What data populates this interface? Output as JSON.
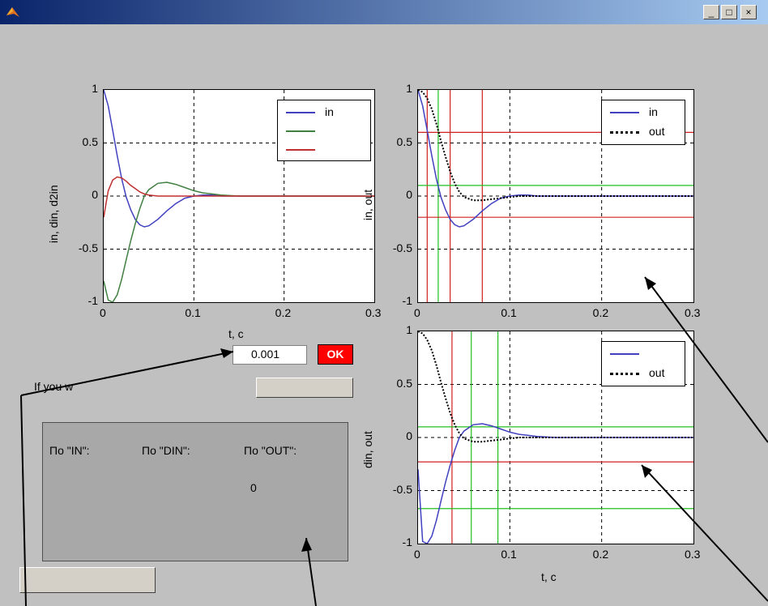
{
  "window": {
    "title": "",
    "minimize_label": "_",
    "maximize_label": "□",
    "close_label": "×"
  },
  "menu": {
    "items": [
      "",
      "",
      "",
      "",
      "",
      ""
    ]
  },
  "figure_title": "",
  "ticks": {
    "y": [
      "1",
      "0.5",
      "0",
      "-0.5",
      "-1"
    ],
    "x": [
      "0",
      "0.1",
      "0.2",
      "0.3"
    ]
  },
  "plots": [
    {
      "id": "plot-in-din-d2in",
      "ylabel": "in, din, d2in",
      "xlabel": "t, c",
      "legend": [
        "in",
        "",
        ""
      ],
      "colors": [
        "#4040c0",
        "#408040",
        "#c03030"
      ],
      "hidden_y_labels": [
        "",
        ""
      ]
    },
    {
      "id": "plot-in-out",
      "ylabel": "in, out",
      "xlabel": "",
      "legend": [
        "in",
        "out"
      ],
      "colors": [
        "#4040c0",
        "#000000"
      ],
      "vlines_red": [
        0.01,
        0.035,
        0.07
      ],
      "vlines_green": [
        0.022
      ],
      "hlines_red": [
        0.6,
        -0.2
      ],
      "hlines_green": [
        0.1
      ]
    },
    {
      "id": "plot-din-out",
      "ylabel": "din, out",
      "xlabel": "t, c",
      "legend": [
        "",
        "out"
      ],
      "colors": [
        "#4040c0",
        "#000000"
      ],
      "vlines_red": [
        0.037
      ],
      "vlines_green": [
        0.058,
        0.087
      ],
      "hlines_red": [
        -0.23
      ],
      "hlines_green": [
        0.1,
        -0.67
      ]
    }
  ],
  "chart_data": [
    {
      "type": "line",
      "x": [
        0,
        0.005,
        0.01,
        0.015,
        0.02,
        0.025,
        0.03,
        0.035,
        0.04,
        0.045,
        0.05,
        0.06,
        0.07,
        0.08,
        0.09,
        0.1,
        0.11,
        0.12,
        0.13,
        0.15,
        0.2,
        0.25,
        0.3
      ],
      "series": [
        {
          "name": "in",
          "values": [
            1,
            0.85,
            0.62,
            0.38,
            0.16,
            -0.01,
            -0.13,
            -0.22,
            -0.27,
            -0.29,
            -0.28,
            -0.22,
            -0.14,
            -0.07,
            -0.02,
            0,
            0.01,
            0.01,
            0,
            0,
            0,
            0,
            0
          ]
        },
        {
          "name": "",
          "values": [
            -0.8,
            -0.98,
            -1,
            -0.93,
            -0.78,
            -0.6,
            -0.42,
            -0.26,
            -0.12,
            0,
            0.06,
            0.12,
            0.13,
            0.11,
            0.08,
            0.05,
            0.03,
            0.02,
            0.01,
            0,
            0,
            0,
            0
          ]
        },
        {
          "name": "",
          "values": [
            -0.2,
            0.05,
            0.15,
            0.18,
            0.17,
            0.14,
            0.1,
            0.07,
            0.04,
            0.02,
            0.01,
            0,
            0,
            0,
            0,
            0,
            0,
            0,
            0,
            0,
            0,
            0,
            0
          ]
        }
      ],
      "xlabel": "t, c",
      "ylabel": "in, din, d2in",
      "xlim": [
        0,
        0.3
      ],
      "ylim": [
        -1,
        1
      ],
      "grid": true,
      "legend": "top-right"
    },
    {
      "type": "line",
      "x": [
        0,
        0.005,
        0.01,
        0.015,
        0.02,
        0.025,
        0.03,
        0.035,
        0.04,
        0.045,
        0.05,
        0.06,
        0.07,
        0.08,
        0.09,
        0.1,
        0.11,
        0.12,
        0.13,
        0.15,
        0.2,
        0.25,
        0.3
      ],
      "series": [
        {
          "name": "in",
          "values": [
            1,
            0.85,
            0.62,
            0.38,
            0.16,
            -0.01,
            -0.13,
            -0.22,
            -0.27,
            -0.29,
            -0.28,
            -0.22,
            -0.14,
            -0.07,
            -0.02,
            0,
            0.01,
            0.01,
            0,
            0,
            0,
            0,
            0
          ]
        },
        {
          "name": "out",
          "values": [
            1,
            0.98,
            0.92,
            0.82,
            0.68,
            0.52,
            0.37,
            0.23,
            0.12,
            0.04,
            -0.01,
            -0.04,
            -0.04,
            -0.03,
            -0.02,
            -0.01,
            0,
            0,
            0,
            0,
            0,
            0,
            0
          ]
        }
      ],
      "xlabel": "",
      "ylabel": "in, out",
      "xlim": [
        0,
        0.3
      ],
      "ylim": [
        -1,
        1
      ],
      "grid": true,
      "legend": "top-right"
    },
    {
      "type": "line",
      "x": [
        0,
        0.005,
        0.01,
        0.015,
        0.02,
        0.025,
        0.03,
        0.035,
        0.04,
        0.045,
        0.05,
        0.06,
        0.07,
        0.08,
        0.09,
        0.1,
        0.11,
        0.12,
        0.13,
        0.15,
        0.2,
        0.25,
        0.3
      ],
      "series": [
        {
          "name": "",
          "values": [
            -0.3,
            -0.98,
            -1,
            -0.93,
            -0.78,
            -0.6,
            -0.42,
            -0.26,
            -0.12,
            0,
            0.06,
            0.12,
            0.13,
            0.11,
            0.08,
            0.05,
            0.03,
            0.02,
            0.01,
            0,
            0,
            0,
            0
          ]
        },
        {
          "name": "out",
          "values": [
            1,
            0.98,
            0.92,
            0.82,
            0.68,
            0.52,
            0.37,
            0.23,
            0.12,
            0.04,
            -0.01,
            -0.04,
            -0.04,
            -0.03,
            -0.02,
            -0.01,
            0,
            0,
            0,
            0,
            0,
            0,
            0
          ]
        }
      ],
      "xlabel": "t, c",
      "ylabel": "din, out",
      "xlim": [
        0,
        0.3
      ],
      "ylim": [
        -1,
        1
      ],
      "grid": true,
      "legend": "top-right"
    }
  ],
  "controls": {
    "step_label": "",
    "step_value": "0.001",
    "ok_label": "OK",
    "prompt_label": "If you w",
    "prompt_button_label": "",
    "prompt_line2": ""
  },
  "results": {
    "title": "",
    "col_in": "По \"IN\":",
    "col_din": "По \"DIN\":",
    "col_out": "По \"OUT\":",
    "out_value": "0"
  },
  "bottom_button_label": ""
}
